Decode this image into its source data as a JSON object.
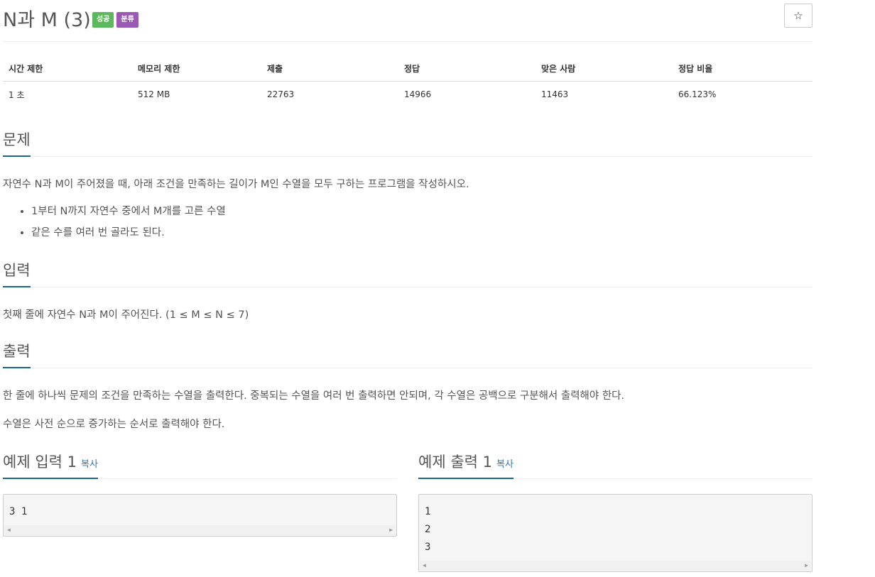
{
  "problem": {
    "title": "N과 M (3)",
    "badges": [
      {
        "label": "성공",
        "color": "#5cb85c"
      },
      {
        "label": "분류",
        "color": "#9b59b6"
      }
    ],
    "star_icon": "☆"
  },
  "info": {
    "headers": [
      "시간 제한",
      "메모리 제한",
      "제출",
      "정답",
      "맞은 사람",
      "정답 비율"
    ],
    "values": [
      "1 초",
      "512 MB",
      "22763",
      "14966",
      "11463",
      "66.123%"
    ]
  },
  "sections": {
    "problem": {
      "title": "문제",
      "text": "자연수 N과 M이 주어졌을 때, 아래 조건을 만족하는 길이가 M인 수열을 모두 구하는 프로그램을 작성하시오.",
      "items": [
        "1부터 N까지 자연수 중에서 M개를 고른 수열",
        "같은 수를 여러 번 골라도 된다."
      ]
    },
    "input": {
      "title": "입력",
      "text": "첫째 줄에 자연수 N과 M이 주어진다. (1 ≤ M ≤ N ≤ 7)"
    },
    "output": {
      "title": "출력",
      "text1": "한 줄에 하나씩 문제의 조건을 만족하는 수열을 출력한다. 중복되는 수열을 여러 번 출력하면 안되며, 각 수열은 공백으로 구분해서 출력해야 한다.",
      "text2": "수열은 사전 순으로 증가하는 순서로 출력해야 한다."
    }
  },
  "samples": {
    "input": {
      "title": "예제 입력 1",
      "copy_label": "복사",
      "content": "3 1"
    },
    "output": {
      "title": "예제 출력 1",
      "copy_label": "복사",
      "content": "1\n2\n3"
    }
  }
}
